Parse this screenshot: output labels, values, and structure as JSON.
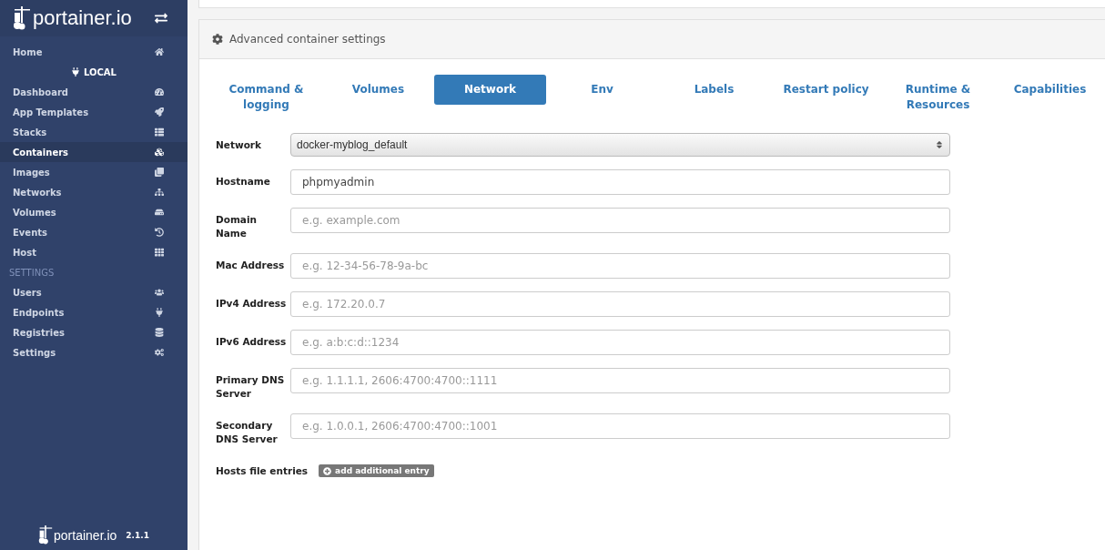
{
  "sidebar": {
    "brand": "portainer.io",
    "items": [
      {
        "kind": "link",
        "label": "Home",
        "selected": false
      },
      {
        "kind": "endpoint",
        "label": "LOCAL"
      },
      {
        "kind": "link",
        "label": "Dashboard",
        "selected": false
      },
      {
        "kind": "link",
        "label": "App Templates",
        "selected": false
      },
      {
        "kind": "link",
        "label": "Stacks",
        "selected": false
      },
      {
        "kind": "link",
        "label": "Containers",
        "selected": true
      },
      {
        "kind": "link",
        "label": "Images",
        "selected": false
      },
      {
        "kind": "link",
        "label": "Networks",
        "selected": false
      },
      {
        "kind": "link",
        "label": "Volumes",
        "selected": false
      },
      {
        "kind": "link",
        "label": "Events",
        "selected": false
      },
      {
        "kind": "link",
        "label": "Host",
        "selected": false
      },
      {
        "kind": "section",
        "label": "SETTINGS"
      },
      {
        "kind": "link",
        "label": "Users",
        "selected": false
      },
      {
        "kind": "link",
        "label": "Endpoints",
        "selected": false
      },
      {
        "kind": "link",
        "label": "Registries",
        "selected": false
      },
      {
        "kind": "link",
        "label": "Settings",
        "selected": false
      }
    ],
    "footer": {
      "brand": "portainer.io",
      "version": "2.1.1"
    }
  },
  "panel": {
    "title": "Advanced container settings",
    "tabs": [
      {
        "label": "Command & logging",
        "selected": false
      },
      {
        "label": "Volumes",
        "selected": false
      },
      {
        "label": "Network",
        "selected": true
      },
      {
        "label": "Env",
        "selected": false
      },
      {
        "label": "Labels",
        "selected": false
      },
      {
        "label": "Restart policy",
        "selected": false
      },
      {
        "label": "Runtime & Resources",
        "selected": false
      },
      {
        "label": "Capabilities",
        "selected": false
      }
    ],
    "fields": [
      {
        "kind": "select",
        "label": "Network",
        "value": "docker-myblog_default"
      },
      {
        "kind": "input",
        "label": "Hostname",
        "value": "phpmyadmin"
      },
      {
        "kind": "input",
        "label": "Domain Name",
        "placeholder": "e.g. example.com"
      },
      {
        "kind": "input",
        "label": "Mac Address",
        "placeholder": "e.g. 12-34-56-78-9a-bc"
      },
      {
        "kind": "input",
        "label": "IPv4 Address",
        "placeholder": "e.g. 172.20.0.7"
      },
      {
        "kind": "input",
        "label": "IPv6 Address",
        "placeholder": "e.g. a:b:c:d::1234"
      },
      {
        "kind": "input",
        "label": "Primary DNS Server",
        "placeholder": "e.g. 1.1.1.1, 2606:4700:4700::1111"
      },
      {
        "kind": "input",
        "label": "Secondary DNS Server",
        "placeholder": "e.g. 1.0.0.1, 2606:4700:4700::1001"
      }
    ],
    "hosts": {
      "label": "Hosts file entries",
      "button": "add additional entry"
    }
  }
}
